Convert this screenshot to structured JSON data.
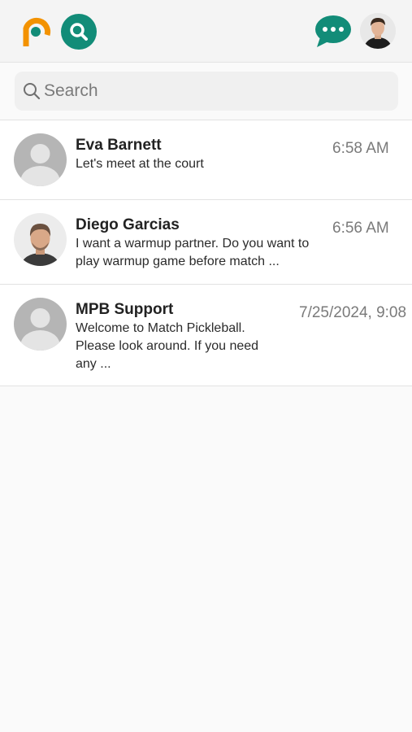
{
  "header": {
    "logo_icon": "app-logo-icon",
    "search_icon": "search-icon",
    "chat_icon": "chat-bubble-icon",
    "profile_icon": "user-avatar"
  },
  "search": {
    "placeholder": "Search",
    "value": ""
  },
  "conversations": [
    {
      "name": "Eva Barnett",
      "message": "Let's meet at the court",
      "time": "6:58 AM",
      "avatar": "default-avatar"
    },
    {
      "name": "Diego Garcias",
      "message": "I want a warmup partner. Do you want to play warmup game before match ...",
      "time": "6:56 AM",
      "avatar": "photo-avatar"
    },
    {
      "name": "MPB Support",
      "message": "Welcome to Match Pickleball. Please look around. If you need any ...",
      "time": "7/25/2024, 9:08",
      "avatar": "default-avatar"
    }
  ],
  "colors": {
    "brand_orange": "#f39200",
    "brand_teal": "#128c78",
    "text_muted": "#7a7a7a"
  }
}
